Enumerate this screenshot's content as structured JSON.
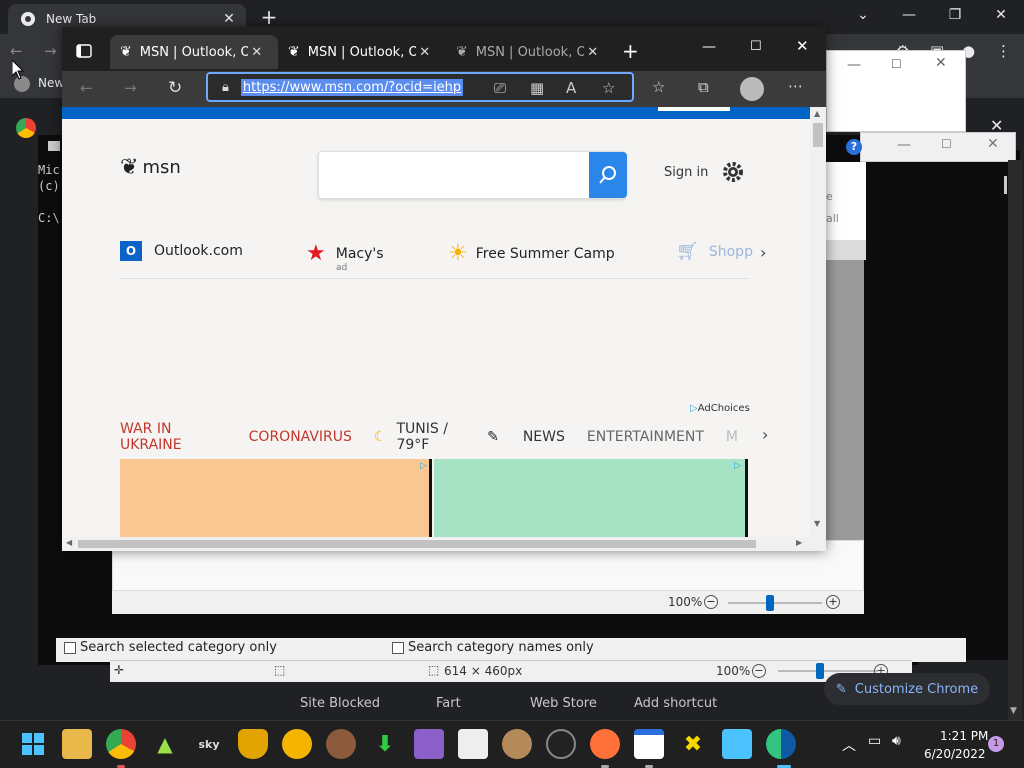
{
  "chrome": {
    "tab_title": "New Tab",
    "bookmark_partial": "New",
    "shortcuts": [
      "Site Blocked",
      "Fart",
      "Web Store",
      "Add shortcut"
    ],
    "customize_label": "Customize Chrome"
  },
  "cmd": {
    "lines": [
      "Mic",
      "(c)",
      "",
      "C:\\"
    ]
  },
  "dialog": {
    "partial_a": "e",
    "partial_b": "all",
    "help_label": "?"
  },
  "viewer": {
    "zoom": "100%"
  },
  "categories": {
    "option1": "Search selected category only",
    "option2": "Search category names only"
  },
  "paint": {
    "size": "614 × 460px",
    "zoom": "100%"
  },
  "edge": {
    "tabs": [
      {
        "label": "MSN | Outlook, Off"
      },
      {
        "label": "MSN | Outlook, Off"
      },
      {
        "label": "MSN | Outlook, Off"
      }
    ],
    "url": "https://www.msn.com/?ocid=iehp"
  },
  "msn": {
    "logo_text": "msn",
    "sign_in": "Sign in",
    "quicklinks": [
      {
        "label": "Outlook.com",
        "sub": ""
      },
      {
        "label": "Macy's",
        "sub": "ad"
      },
      {
        "label": "Free Summer Camp",
        "sub": ""
      },
      {
        "label": "Shopp",
        "sub": ""
      }
    ],
    "adchoices": "AdChoices",
    "topics": {
      "t1": "WAR IN UKRAINE",
      "t2": "CORONAVIRUS",
      "weather": "TUNIS / 79°F",
      "t3": "NEWS",
      "t4": "ENTERTAINMENT",
      "t5": "M"
    }
  },
  "taskbar": {
    "time": "1:21 PM",
    "date": "6/20/2022",
    "notification_count": "1"
  }
}
